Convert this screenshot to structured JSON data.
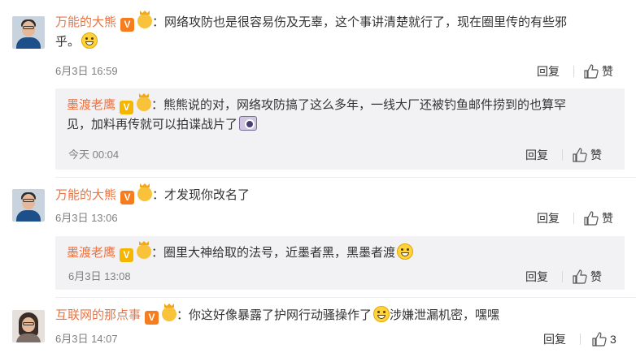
{
  "comments": [
    {
      "user": "万能的大熊",
      "badge": "V",
      "text_line1": "：网络攻防也是很容易伤及无辜，这个事讲清楚就行了，现在圈里传的有些邪",
      "text_line2": "乎。",
      "emoji": "laugh-emoji",
      "time": "6月3日 16:59",
      "reply_label": "回复",
      "like_label": "赞",
      "reply": {
        "user": "墨渡老鹰",
        "badge": "V",
        "text_line1": "：熊熊说的对，网络攻防搞了这么多年，一线大厂还被钓鱼邮件捞到的也算罕",
        "text_line2": "见，加料再传就可以拍谍战片了",
        "emoji": "camera-emoji",
        "time": "今天 00:04",
        "reply_label": "回复",
        "like_label": "赞"
      }
    },
    {
      "user": "万能的大熊",
      "badge": "V",
      "text_line1": "：才发现你改名了",
      "time": "6月3日 13:06",
      "reply_label": "回复",
      "like_label": "赞",
      "reply": {
        "user": "墨渡老鹰",
        "badge": "V",
        "text_line1": "：圈里大神给取的法号，近墨者黑，黑墨者渡",
        "emoji": "smirk-emoji",
        "time": "6月3日 13:08",
        "reply_label": "回复",
        "like_label": "赞"
      }
    },
    {
      "user": "互联网的那点事",
      "badge": "V",
      "text_line1": "：你这好像暴露了护网行动骚操作了",
      "text_mid": "涉嫌泄漏机密，嘿嘿",
      "emoji": "smirk-emoji",
      "time": "6月3日 14:07",
      "reply_label": "回复",
      "like_count": "3"
    }
  ],
  "colors": {
    "username": "#eb7340",
    "badge_orange": "#f77c1e",
    "badge_gold": "#f5b600",
    "reply_bg": "#f2f2f5",
    "meta": "#808080"
  }
}
